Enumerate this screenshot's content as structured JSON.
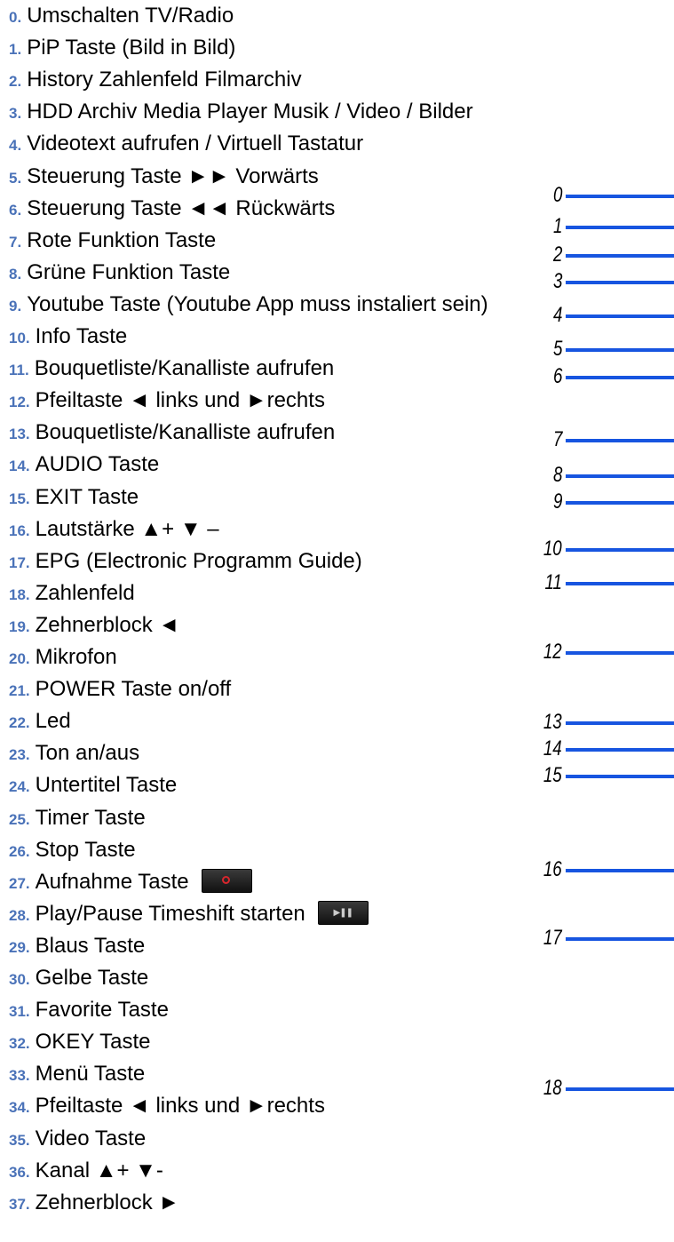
{
  "items": [
    {
      "num": "0.",
      "text": "Umschalten TV/Radio"
    },
    {
      "num": "1.",
      "text": "PiP Taste (Bild in Bild)"
    },
    {
      "num": "2.",
      "text": "History Zahlenfeld Filmarchiv"
    },
    {
      "num": "3.",
      "text": "HDD Archiv Media Player Musik / Video / Bilder"
    },
    {
      "num": "4.",
      "text": "Videotext aufrufen / Virtuell Tastatur"
    },
    {
      "num": "5.",
      "text": "Steuerung Taste ►► Vorwärts"
    },
    {
      "num": "6.",
      "text": "Steuerung Taste ◄◄ Rückwärts"
    },
    {
      "num": "7.",
      "text": "Rote Funktion Taste"
    },
    {
      "num": "8.",
      "text": "Grüne Funktion Taste"
    },
    {
      "num": "9.",
      "text": "Youtube Taste (Youtube App muss instaliert sein)"
    },
    {
      "num": "10.",
      "text": "Info Taste"
    },
    {
      "num": "11.",
      "text": "Bouquetliste/Kanalliste aufrufen"
    },
    {
      "num": "12.",
      "text": "Pfeiltaste ◄ links und ►rechts"
    },
    {
      "num": "13.",
      "text": "Bouquetliste/Kanalliste aufrufen"
    },
    {
      "num": "14.",
      "text": "AUDIO Taste"
    },
    {
      "num": "15.",
      "text": "EXIT Taste"
    },
    {
      "num": "16.",
      "text": "Lautstärke ▲+ ▼ –"
    },
    {
      "num": "17.",
      "text": "EPG (Electronic Programm Guide)"
    },
    {
      "num": "18.",
      "text": "Zahlenfeld"
    },
    {
      "num": "19.",
      "text": "Zehnerblock ◄"
    },
    {
      "num": "20.",
      "text": "Mikrofon"
    },
    {
      "num": "21.",
      "text": "POWER Taste on/off"
    },
    {
      "num": "22.",
      "text": "Led"
    },
    {
      "num": "23.",
      "text": "Ton an/aus"
    },
    {
      "num": "24.",
      "text": "Untertitel Taste"
    },
    {
      "num": "25.",
      "text": "Timer Taste"
    },
    {
      "num": "26.",
      "text": "Stop Taste"
    },
    {
      "num": "27.",
      "text": "Aufnahme Taste",
      "icon": "record-button-icon"
    },
    {
      "num": "28.",
      "text": "Play/Pause Timeshift starten",
      "icon": "play-pause-button-icon"
    },
    {
      "num": "29.",
      "text": "Blaus Taste"
    },
    {
      "num": "30.",
      "text": "Gelbe Taste"
    },
    {
      "num": "31.",
      "text": "Favorite Taste"
    },
    {
      "num": "32.",
      "text": "OKEY Taste"
    },
    {
      "num": "33.",
      "text": "Menü Taste"
    },
    {
      "num": "34.",
      "text": "Pfeiltaste ◄ links und ►rechts"
    },
    {
      "num": "35.",
      "text": "Video Taste"
    },
    {
      "num": "36.",
      "text": "Kanal ▲+ ▼-"
    },
    {
      "num": "37.",
      "text": "Zehnerblock ►"
    }
  ],
  "markers": [
    "0",
    "1",
    "2",
    "3",
    "4",
    "5",
    "6",
    "7",
    "8",
    "9",
    "10",
    "11",
    "12",
    "13",
    "14",
    "15",
    "16",
    "17",
    "18"
  ],
  "colors": {
    "number": "#4a72b8",
    "text": "#000000",
    "marker_line": "#1755e0",
    "record": "#d8262d"
  }
}
